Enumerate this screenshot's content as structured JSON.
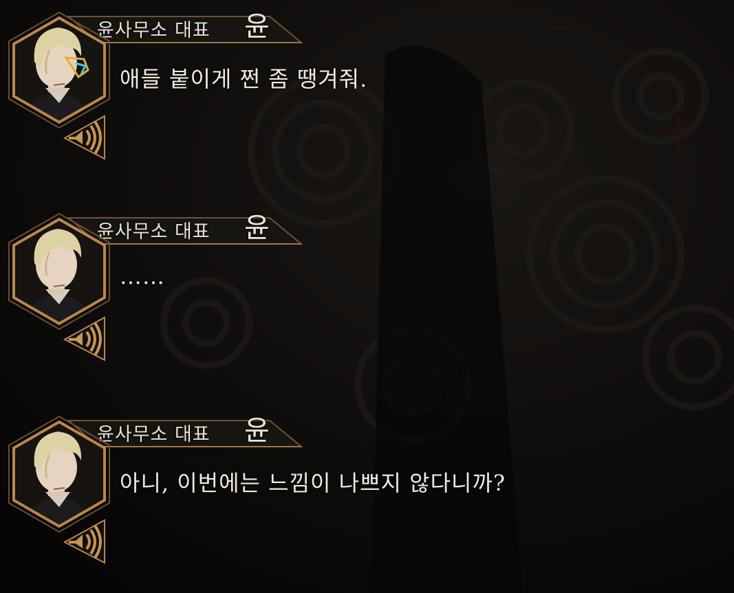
{
  "dialogue": [
    {
      "speaker_title": "윤사무소 대표",
      "speaker_name": "윤",
      "text": "애들 붙이게 쩐 좀 땡겨줘.",
      "icon": "speaker-icon",
      "has_glasses": true
    },
    {
      "speaker_title": "윤사무소 대표",
      "speaker_name": "윤",
      "text": "……",
      "icon": "speaker-icon",
      "has_glasses": false
    },
    {
      "speaker_title": "윤사무소 대표",
      "speaker_name": "윤",
      "text": "아니, 이번에는 느낌이 나쁘지 않다니까?",
      "icon": "speaker-icon",
      "has_glasses": false
    }
  ],
  "colors": {
    "background": "#0b0a09",
    "frame_gold": "#b98848",
    "text": "#efeae0",
    "glasses_accent": "#3ec9ea",
    "glasses_frame": "#e0b12a"
  }
}
